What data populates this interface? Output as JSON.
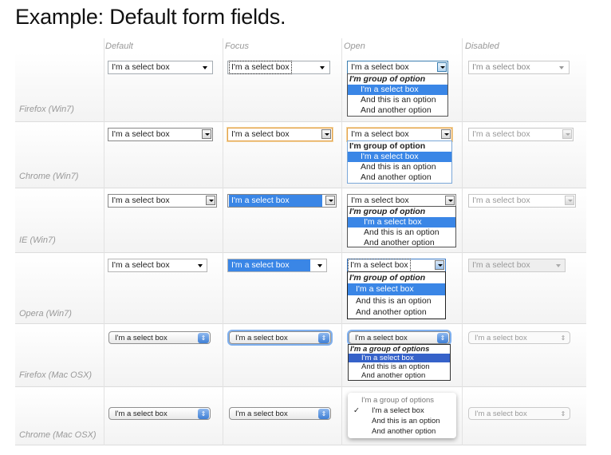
{
  "title": "Example: Default form fields.",
  "columns": {
    "default": "Default",
    "focus": "Focus",
    "open": "Open",
    "disabled": "Disabled"
  },
  "rows": {
    "ffwin": "Firefox (Win7)",
    "chrwin": "Chrome (Win7)",
    "iewin": "IE (Win7)",
    "opwin": "Opera (Win7)",
    "ffmac": "Firefox (Mac OSX)",
    "chrmac": "Chrome (Mac OSX)"
  },
  "select_label": "I'm a select box",
  "options": {
    "group": "I'm group of option",
    "group_mac_ff": "I'm a group of options",
    "group_mac_chrome": "I'm a group of options",
    "opt1": "I'm a select box",
    "opt2": "And this is an option",
    "opt3": "And another option"
  },
  "icons": {
    "checkmark": "✓",
    "mac_stepper": "⇕"
  }
}
